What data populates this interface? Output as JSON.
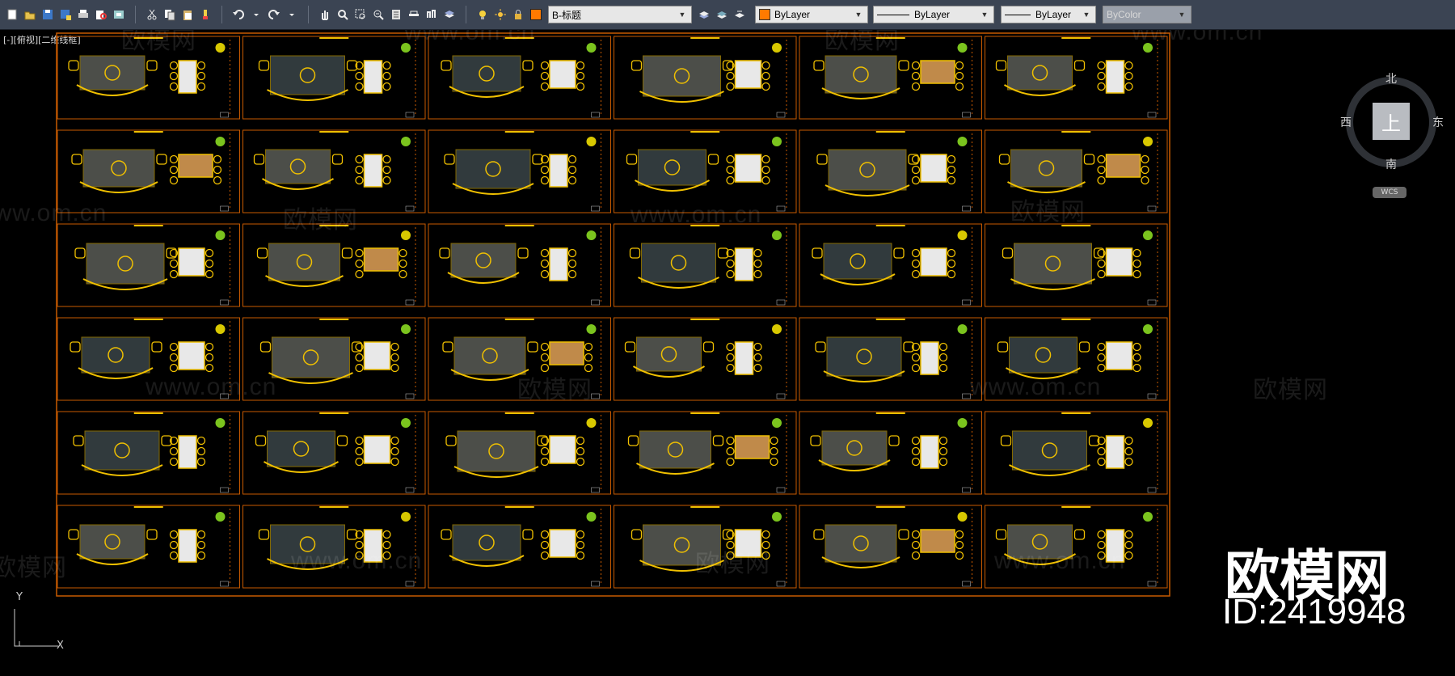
{
  "toolbar": {
    "layer_combo": "B-标题",
    "layer_color": "#ff7a00",
    "color_combo": "ByLayer",
    "color_swatch": "#ff7a00",
    "linetype_combo": "ByLayer",
    "lineweight_combo": "ByLayer",
    "plotstyle_combo": "ByColor",
    "icons": [
      "new-icon",
      "open-icon",
      "save-icon",
      "saveas-icon",
      "print-icon",
      "plot-preview-icon",
      "publish-icon",
      "cut-icon",
      "copy-icon",
      "paste-icon",
      "match-properties-icon",
      "undo-icon",
      "redo-icon",
      "pan-icon",
      "zoom-realtime-icon",
      "zoom-window-icon",
      "zoom-previous-icon",
      "properties-icon",
      "design-center-icon",
      "tool-palettes-icon",
      "layer-properties-icon",
      "layer-state-icon",
      "make-current-icon",
      "layer-previous-icon"
    ]
  },
  "canvas": {
    "view_label": "[-][俯视][二维线框]",
    "watermark_text": "www.om.cn",
    "watermark_brand": "欧模网",
    "brand_big": "欧模网",
    "id_text": "ID:2419948"
  },
  "viewcube": {
    "north": "北",
    "south": "南",
    "east": "东",
    "west": "西",
    "top_face": "上",
    "wcs": "WCS"
  },
  "ucs": {
    "x": "X",
    "y": "Y"
  },
  "drawing": {
    "frame_color": "#c85a00",
    "line_color": "#f0c000",
    "plant_color": "#7bc41e",
    "rows": 6,
    "cols": 6
  }
}
